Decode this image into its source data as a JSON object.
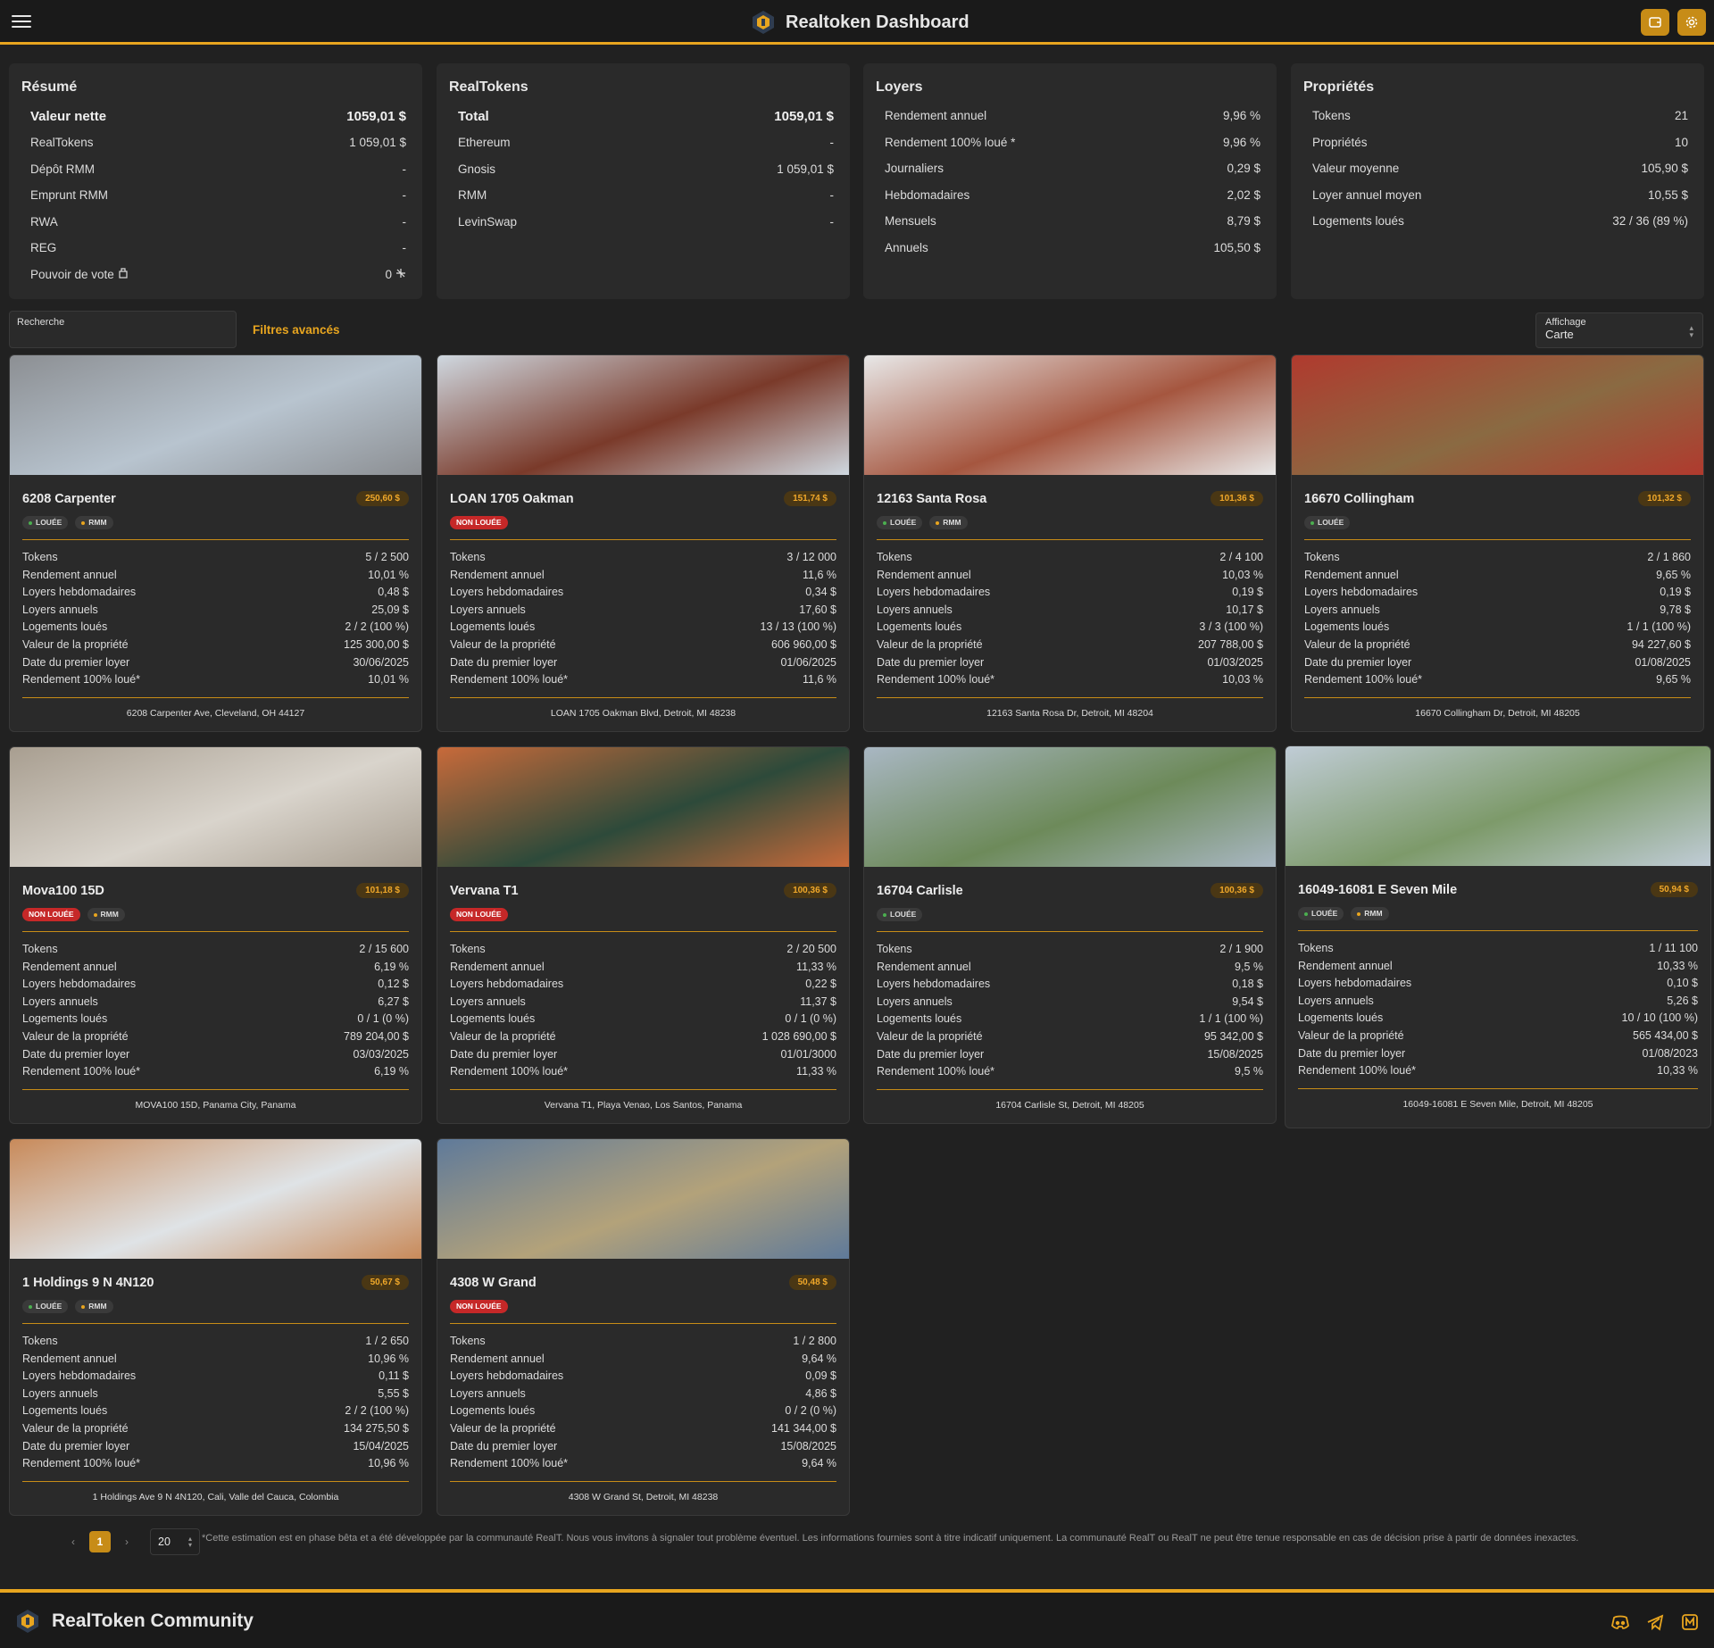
{
  "header": {
    "title": "Realtoken Dashboard"
  },
  "summary": [
    {
      "title": "Résumé",
      "big": {
        "label": "Valeur nette",
        "value": "1059,01 $"
      },
      "rows": [
        {
          "label": "RealTokens",
          "value": "1 059,01 $"
        },
        {
          "label": "Dépôt RMM",
          "value": "-"
        },
        {
          "label": "Emprunt RMM",
          "value": "-"
        },
        {
          "label": "RWA",
          "value": "-"
        },
        {
          "label": "REG",
          "value": "-"
        },
        {
          "label": "Pouvoir de vote",
          "value": "0"
        }
      ]
    },
    {
      "title": "RealTokens",
      "big": {
        "label": "Total",
        "value": "1059,01 $"
      },
      "rows": [
        {
          "label": "Ethereum",
          "value": "-"
        },
        {
          "label": "Gnosis",
          "value": "1 059,01 $"
        },
        {
          "label": "RMM",
          "value": "-"
        },
        {
          "label": "LevinSwap",
          "value": "-"
        }
      ]
    },
    {
      "title": "Loyers",
      "rows": [
        {
          "label": "Rendement annuel",
          "value": "9,96 %"
        },
        {
          "label": "Rendement 100% loué *",
          "value": "9,96 %"
        },
        {
          "label": "Journaliers",
          "value": "0,29 $"
        },
        {
          "label": "Hebdomadaires",
          "value": "2,02 $"
        },
        {
          "label": "Mensuels",
          "value": "8,79 $"
        },
        {
          "label": "Annuels",
          "value": "105,50 $"
        }
      ]
    },
    {
      "title": "Propriétés",
      "rows": [
        {
          "label": "Tokens",
          "value": "21"
        },
        {
          "label": "Propriétés",
          "value": "10"
        },
        {
          "label": "Valeur moyenne",
          "value": "105,90 $"
        },
        {
          "label": "Loyer annuel moyen",
          "value": "10,55 $"
        },
        {
          "label": "Logements loués",
          "value": "32 / 36 (89 %)"
        }
      ]
    }
  ],
  "controls": {
    "search_label": "Recherche",
    "filters_label": "Filtres avancés",
    "display_label": "Affichage",
    "display_value": "Carte"
  },
  "row_labels": [
    "Tokens",
    "Rendement annuel",
    "Loyers hebdomadaires",
    "Loyers annuels",
    "Logements loués",
    "Valeur de la propriété",
    "Date du premier loyer",
    "Rendement 100% loué*"
  ],
  "properties": [
    {
      "name": "6208 Carpenter",
      "price": "250,60 $",
      "chips": [
        {
          "text": "LOUÉE",
          "type": "rented"
        },
        {
          "text": "RMM",
          "type": "rmm"
        }
      ],
      "values": [
        "5 / 2 500",
        "10,01 %",
        "0,48 $",
        "25,09 $",
        "2 / 2 (100 %)",
        "125 300,00 $",
        "30/06/2025",
        "10,01 %"
      ],
      "address": "6208 Carpenter Ave, Cleveland, OH 44127"
    },
    {
      "name": "LOAN 1705 Oakman",
      "price": "151,74 $",
      "chips": [
        {
          "text": "NON LOUÉE",
          "type": "notrented"
        }
      ],
      "values": [
        "3 / 12 000",
        "11,6 %",
        "0,34 $",
        "17,60 $",
        "13 / 13 (100 %)",
        "606 960,00 $",
        "01/06/2025",
        "11,6 %"
      ],
      "address": "LOAN 1705 Oakman Blvd, Detroit, MI 48238"
    },
    {
      "name": "12163 Santa Rosa",
      "price": "101,36 $",
      "chips": [
        {
          "text": "LOUÉE",
          "type": "rented"
        },
        {
          "text": "RMM",
          "type": "rmm"
        }
      ],
      "values": [
        "2 / 4 100",
        "10,03 %",
        "0,19 $",
        "10,17 $",
        "3 / 3 (100 %)",
        "207 788,00 $",
        "01/03/2025",
        "10,03 %"
      ],
      "address": "12163 Santa Rosa Dr, Detroit, MI 48204"
    },
    {
      "name": "16670 Collingham",
      "price": "101,32 $",
      "chips": [
        {
          "text": "LOUÉE",
          "type": "rented"
        }
      ],
      "values": [
        "2 / 1 860",
        "9,65 %",
        "0,19 $",
        "9,78 $",
        "1 / 1 (100 %)",
        "94 227,60 $",
        "01/08/2025",
        "9,65 %"
      ],
      "address": "16670 Collingham Dr, Detroit, MI 48205"
    },
    {
      "name": "Mova100 15D",
      "price": "101,18 $",
      "chips": [
        {
          "text": "NON LOUÉE",
          "type": "notrented"
        },
        {
          "text": "RMM",
          "type": "rmm"
        }
      ],
      "values": [
        "2 / 15 600",
        "6,19 %",
        "0,12 $",
        "6,27 $",
        "0 / 1 (0 %)",
        "789 204,00 $",
        "03/03/2025",
        "6,19 %"
      ],
      "address": "MOVA100 15D, Panama City, Panama"
    },
    {
      "name": "Vervana T1",
      "price": "100,36 $",
      "chips": [
        {
          "text": "NON LOUÉE",
          "type": "notrented"
        }
      ],
      "values": [
        "2 / 20 500",
        "11,33 %",
        "0,22 $",
        "11,37 $",
        "0 / 1 (0 %)",
        "1 028 690,00 $",
        "01/01/3000",
        "11,33 %"
      ],
      "address": "Vervana T1, Playa Venao, Los Santos, Panama"
    },
    {
      "name": "16704 Carlisle",
      "price": "100,36 $",
      "chips": [
        {
          "text": "LOUÉE",
          "type": "rented"
        }
      ],
      "values": [
        "2 / 1 900",
        "9,5 %",
        "0,18 $",
        "9,54 $",
        "1 / 1 (100 %)",
        "95 342,00 $",
        "15/08/2025",
        "9,5 %"
      ],
      "address": "16704 Carlisle St, Detroit, MI 48205"
    },
    {
      "name": "16049-16081 E Seven Mile",
      "price": "50,94 $",
      "chips": [
        {
          "text": "LOUÉE",
          "type": "rented"
        },
        {
          "text": "RMM",
          "type": "rmm"
        }
      ],
      "values": [
        "1 / 11 100",
        "10,33 %",
        "0,10 $",
        "5,26 $",
        "10 / 10 (100 %)",
        "565 434,00 $",
        "01/08/2023",
        "10,33 %"
      ],
      "address": "16049-16081 E Seven Mile, Detroit, MI 48205"
    },
    {
      "name": "1 Holdings 9 N 4N120",
      "price": "50,67 $",
      "chips": [
        {
          "text": "LOUÉE",
          "type": "rented"
        },
        {
          "text": "RMM",
          "type": "rmm"
        }
      ],
      "values": [
        "1 / 2 650",
        "10,96 %",
        "0,11 $",
        "5,55 $",
        "2 / 2 (100 %)",
        "134 275,50 $",
        "15/04/2025",
        "10,96 %"
      ],
      "address": "1 Holdings Ave 9 N 4N120, Cali, Valle del Cauca, Colombia"
    },
    {
      "name": "4308 W Grand",
      "price": "50,48 $",
      "chips": [
        {
          "text": "NON LOUÉE",
          "type": "notrented"
        }
      ],
      "values": [
        "1 / 2 800",
        "9,64 %",
        "0,09 $",
        "4,86 $",
        "0 / 2 (0 %)",
        "141 344,00 $",
        "15/08/2025",
        "9,64 %"
      ],
      "address": "4308 W Grand St, Detroit, MI 48238"
    }
  ],
  "pagination": {
    "prev": "‹",
    "current": "1",
    "next": "›",
    "per_page": "20",
    "disclaimer": "*Cette estimation est en phase bêta et a été développée par la communauté RealT. Nous vous invitons à signaler tout problème éventuel. Les informations fournies sont à titre indicatif uniquement. La communauté RealT ou RealT ne peut être tenue responsable en cas de décision prise à partir de données inexactes."
  },
  "footer": {
    "title": "RealToken Community"
  },
  "colors": {
    "accent": "#e8a51f",
    "rented_dot": "#4caf50",
    "rmm_dot": "#e8a51f",
    "not_rented": "#c62828"
  }
}
